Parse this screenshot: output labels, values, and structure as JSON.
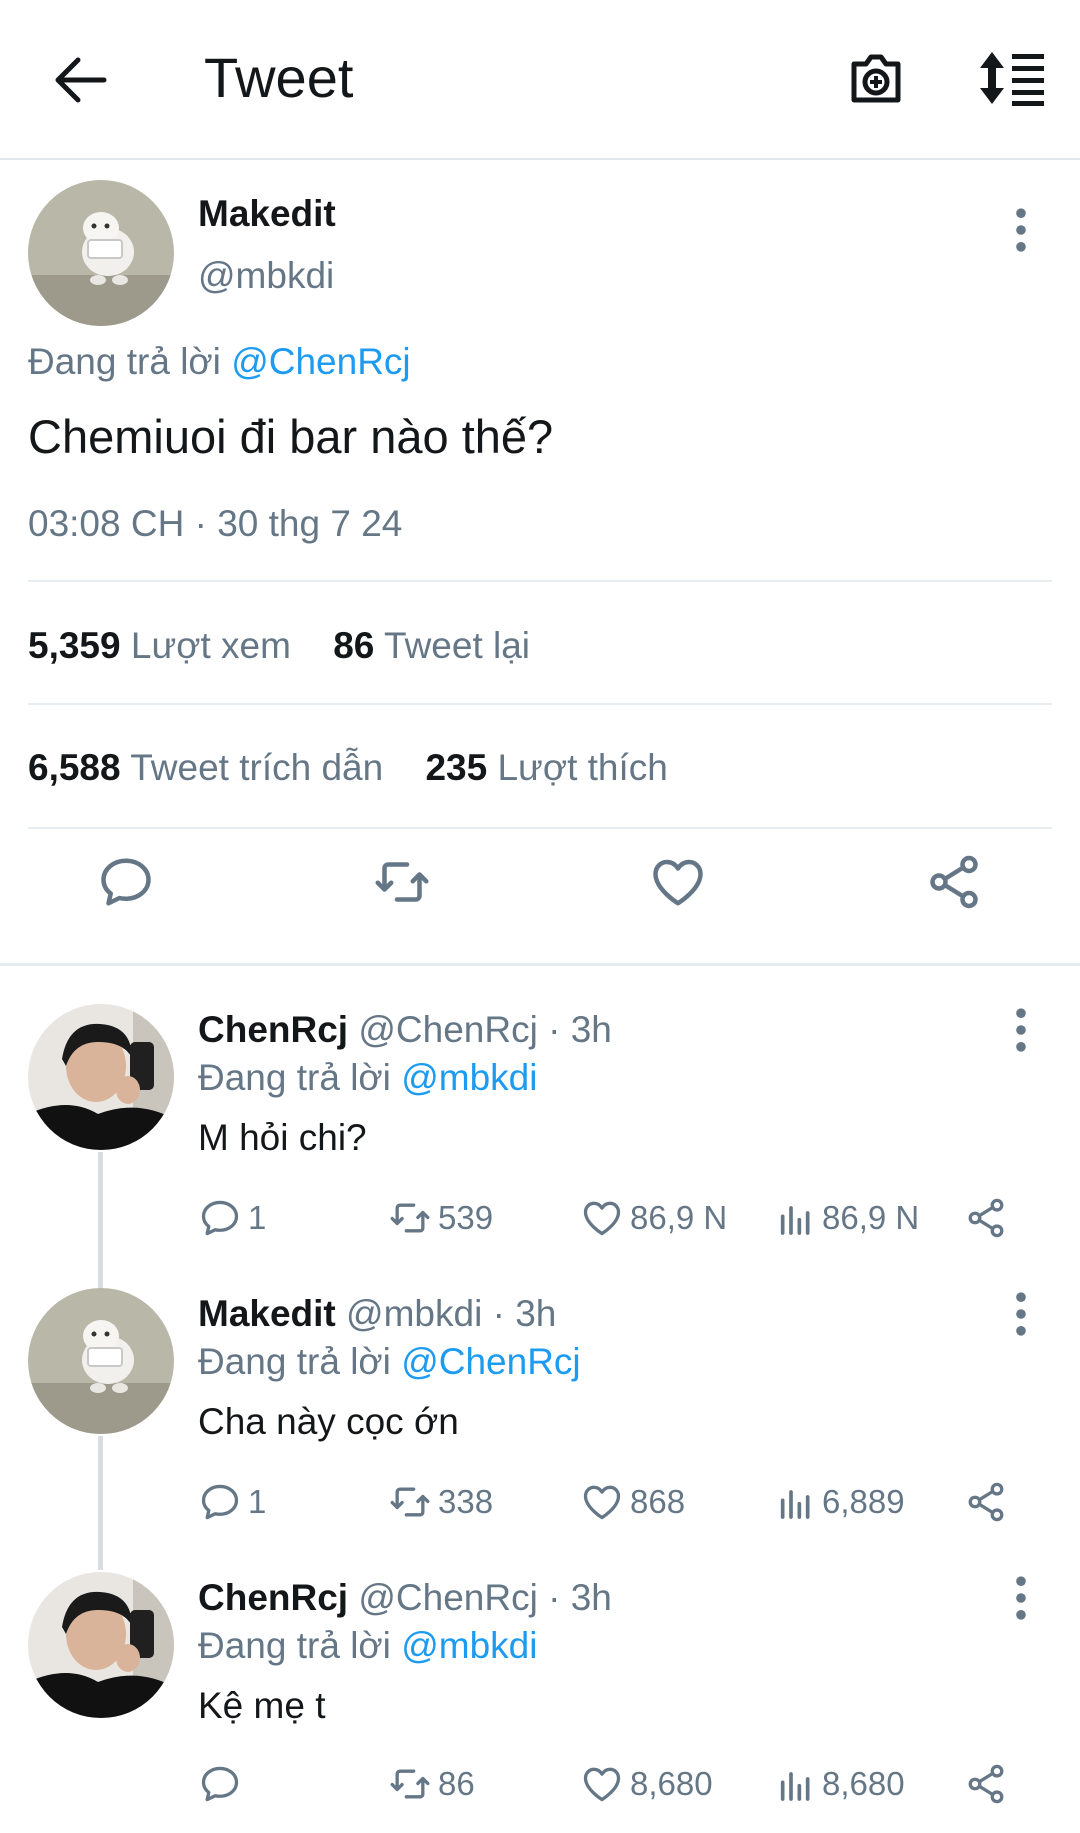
{
  "header": {
    "title": "Tweet",
    "back_icon": "arrow-left-icon",
    "camera_icon": "camera-plus-icon",
    "sort_icon": "sort-list-icon"
  },
  "main_tweet": {
    "name": "Makedit",
    "handle": "@mbkdi",
    "replying_prefix": "Đang trả lời",
    "replying_to": "@ChenRcj",
    "text": "Chemiuoi đi bar nào thế?",
    "timestamp": "03:08 CH · 30 thg 7 24",
    "stats": {
      "views_count": "5,359",
      "views_label": "Lượt xem",
      "retweets_count": "86",
      "retweets_label": "Tweet lại",
      "quotes_count": "6,588",
      "quotes_label": "Tweet trích dẫn",
      "likes_count": "235",
      "likes_label": "Lượt thích"
    }
  },
  "replies": [
    {
      "name": "ChenRcj",
      "handle": "@ChenRcj",
      "time": "· 3h",
      "replying_prefix": "Đang trả lời",
      "replying_to": "@mbkdi",
      "text": "M hỏi chi?",
      "replies": "1",
      "retweets": "539",
      "likes": "86,9 N",
      "views": "86,9 N"
    },
    {
      "name": "Makedit",
      "handle": "@mbkdi",
      "time": "· 3h",
      "replying_prefix": "Đang trả lời",
      "replying_to": "@ChenRcj",
      "text": "Cha này cọc ớn",
      "replies": "1",
      "retweets": "338",
      "likes": "868",
      "views": "6,889"
    },
    {
      "name": "ChenRcj",
      "handle": "@ChenRcj",
      "time": "· 3h",
      "replying_prefix": "Đang trả lời",
      "replying_to": "@mbkdi",
      "text": "Kệ mẹ t",
      "replies": "",
      "retweets": "86",
      "likes": "8,680",
      "views": "8,680"
    }
  ],
  "colors": {
    "link": "#1d9bf0",
    "muted": "#657786",
    "icon": "#657786",
    "text": "#14171a",
    "divider": "#e6ecf0"
  }
}
